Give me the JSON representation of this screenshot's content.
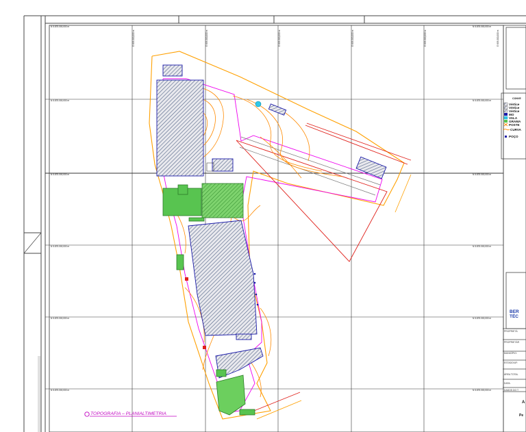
{
  "drawing": {
    "title": "TOPOGRAFIA – PLANIALTIMETRIA",
    "grid_coord_label": "N 5.875.000,000 m",
    "grid_coord_label_vertical": "E 693.000,000 m"
  },
  "legend": {
    "heading": "CONVE",
    "items": [
      {
        "label": "Vértice",
        "swatch": "hatch-gray"
      },
      {
        "label": "Vértice",
        "swatch": "hatch-gray"
      },
      {
        "label": "Vértice",
        "swatch": "hatch-gray"
      },
      {
        "label": "MO",
        "swatch": "blue"
      },
      {
        "label": "VALA",
        "swatch": "cyan"
      },
      {
        "label": "GRAMA",
        "swatch": "green"
      },
      {
        "label": "POSTE",
        "swatch": "orange-x"
      },
      {
        "label": "CURVA",
        "swatch": "orange-line"
      },
      {
        "label": "POÇO",
        "swatch": "blue-dot"
      }
    ]
  },
  "title_block": {
    "heading_line1": "BER",
    "heading_line2": "TÉC",
    "fields": [
      "PROPRIETÁ",
      "PROPRIETÁR",
      "MUNICÍPIO:",
      "ESTADO/UF:",
      "ÁREA TOTAL",
      "DATA:",
      "DADOS DO T"
    ],
    "sheet_letter": "A",
    "sheet_label": "Pe"
  },
  "colors": {
    "grid": "#333333",
    "frame": "#444444",
    "building_hatch": "#5a6b8c",
    "building_outline": "#1a1aa8",
    "grass": "#58c450",
    "contour": "#ff8a00",
    "boundary_red": "#e0201a",
    "boundary_magenta": "#ee00ee",
    "title_text": "#c000c0"
  }
}
